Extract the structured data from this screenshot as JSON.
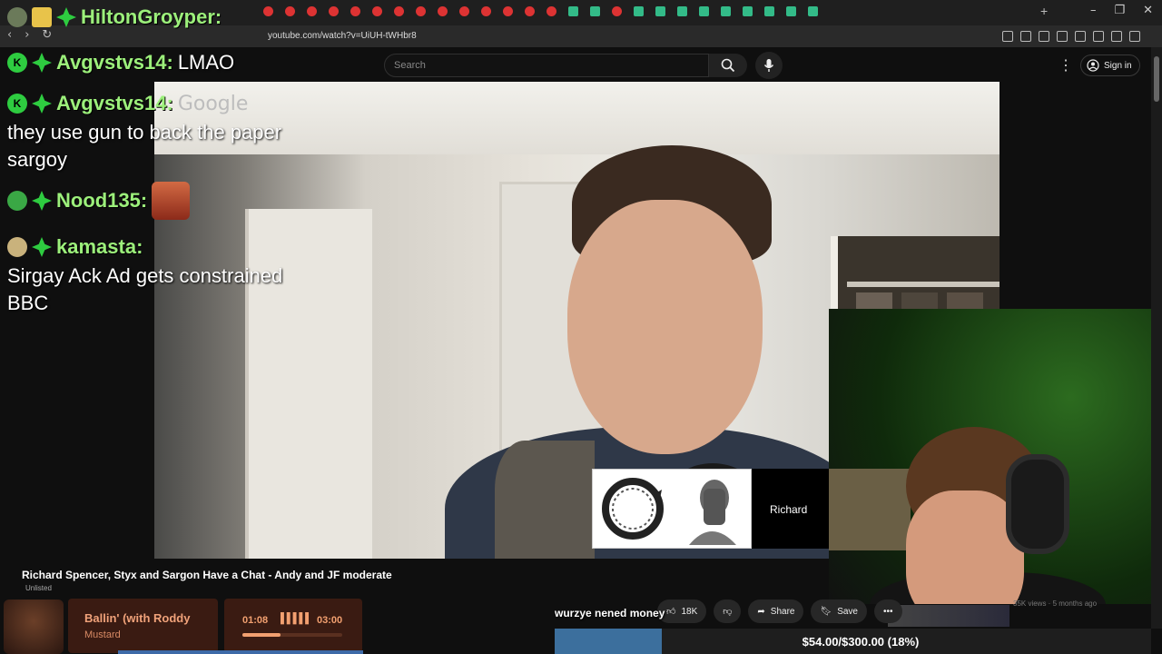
{
  "browser": {
    "url": "youtube.com/watch?v=UiUH-tWHbr8",
    "new_tab": "+",
    "win_min": "–",
    "win_max": "❐",
    "win_close": "✕"
  },
  "youtube": {
    "search_placeholder": "Search",
    "sign_in": "Sign in",
    "video_title": "Richard Spencer, Styx and Sargon Have a Chat - Andy and JF moderate",
    "unlisted": "Unlisted",
    "like_count": "18K",
    "share": "Share",
    "save": "Save",
    "more": "•••",
    "side_meta": "35K views · 5 months ago"
  },
  "chat": [
    {
      "user": "HiltonGroyper:",
      "message": ""
    },
    {
      "user": "Avgvstvs14:",
      "message": "LMAO"
    },
    {
      "user": "Avgvstvs14:",
      "message": "Google",
      "text": "they use gun to back the paper sargoy"
    },
    {
      "user": "Nood135:",
      "message": ""
    },
    {
      "user": "kamasta:",
      "message": "",
      "text": "Sirgay Ack Ad gets constrained BBC"
    }
  ],
  "stream_card": {
    "name": "Richard"
  },
  "music": {
    "title": "Ballin' (with Roddy",
    "artist": "Mustard",
    "current": "01:08",
    "wave": "▌▌▌▌▌",
    "total": "03:00",
    "progress": 0.38
  },
  "donation": {
    "message": "wurzye nened money",
    "goal_text": "$54.00/$300.00 (18%)",
    "goal_fraction": 0.18
  },
  "colors": {
    "chat_name": "#9cf07b",
    "goal_fill": "#3c6f9d",
    "music_accent": "#f2a070"
  }
}
